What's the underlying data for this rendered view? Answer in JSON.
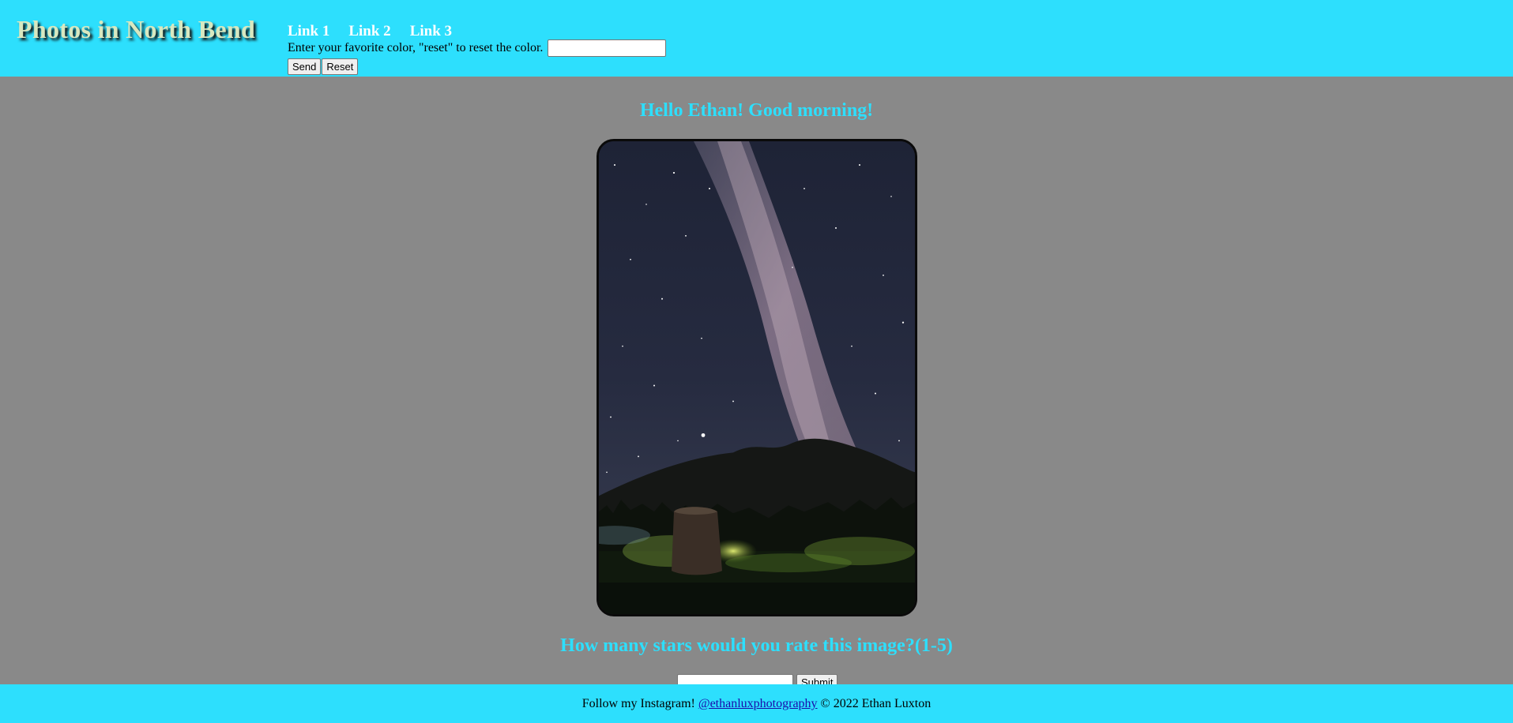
{
  "header": {
    "site_title": "Photos in North Bend",
    "nav": [
      {
        "label": "Link 1"
      },
      {
        "label": "Link 2"
      },
      {
        "label": "Link 3"
      }
    ],
    "color_form": {
      "prompt": "Enter your favorite color, \"reset\" to reset the color.",
      "value": "",
      "send_label": "Send",
      "reset_label": "Reset"
    },
    "background_color": "#2ddffd"
  },
  "main": {
    "greeting": "Hello Ethan! Good morning!",
    "photo_alt": "Milky Way over mountains with a tree stump",
    "rating": {
      "question": "How many stars would you rate this image?(1-5)",
      "value": "",
      "submit_label": "Submit"
    },
    "background_color": "#898989",
    "accent_color": "#2ddffd"
  },
  "footer": {
    "prefix": "Follow my Instagram!",
    "link_text": "@ethanluxphotography",
    "suffix": "© 2022 Ethan Luxton"
  }
}
